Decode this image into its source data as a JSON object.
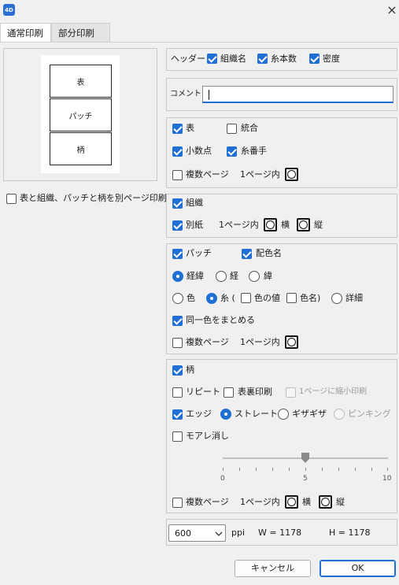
{
  "window": {
    "app_icon": "4D",
    "close_icon": "×"
  },
  "tabs": [
    {
      "label": "通常印刷"
    },
    {
      "label": "部分印刷"
    }
  ],
  "preview": {
    "boxes": [
      "表",
      "パッチ",
      "柄"
    ]
  },
  "separate_pages": {
    "label": "表と組織、パッチと柄を別ページ印刷",
    "checked": false
  },
  "header": {
    "label": "ヘッダー",
    "org_name": {
      "label": "組織名",
      "checked": true
    },
    "yarn_count": {
      "label": "糸本数",
      "checked": true
    },
    "density": {
      "label": "密度",
      "checked": true
    }
  },
  "comment": {
    "label": "コメント",
    "value": ""
  },
  "table": {
    "table": {
      "label": "表",
      "checked": true
    },
    "merge": {
      "label": "統合",
      "checked": false
    },
    "decimal": {
      "label": "小数点",
      "checked": true
    },
    "yarn_no": {
      "label": "糸番手",
      "checked": true
    },
    "multi_page": {
      "label": "複数ページ",
      "checked": false
    },
    "within_1page": "1ページ内"
  },
  "weave": {
    "weave": {
      "label": "組織",
      "checked": true
    },
    "separate_paper": {
      "label": "別紙",
      "checked": true
    },
    "within_1page": "1ページ内",
    "horizontal": "横",
    "vertical": "縦"
  },
  "patch": {
    "patch": {
      "label": "パッチ",
      "checked": true
    },
    "color_name": {
      "label": "配色名",
      "checked": true
    },
    "warp_weft": "経緯",
    "warp": "経",
    "weft": "緯",
    "color": "色",
    "yarn": "糸 (",
    "color_value": "色の値",
    "color_name2": "色名)",
    "detail": "詳細",
    "group_same": {
      "label": "同一色をまとめる",
      "checked": true
    },
    "multi_page": {
      "label": "複数ページ",
      "checked": false
    },
    "within_1page": "1ページ内"
  },
  "pattern": {
    "pattern": {
      "label": "柄",
      "checked": true
    },
    "repeat": {
      "label": "リピート",
      "checked": false
    },
    "front_back": {
      "label": "表裏印刷",
      "checked": false
    },
    "shrink": {
      "label": "1ページに縮小印刷",
      "checked": false
    },
    "edge": {
      "label": "エッジ",
      "checked": true
    },
    "straight": "ストレート",
    "zigzag": "ギザギザ",
    "pinking": "ピンキング",
    "moire": {
      "label": "モアレ消し",
      "checked": false
    },
    "slider": {
      "min": "0",
      "mid": "5",
      "max": "10",
      "value": 5
    },
    "multi_page": {
      "label": "複数ページ",
      "checked": false
    },
    "within_1page": "1ページ内",
    "horizontal": "横",
    "vertical": "縦"
  },
  "resolution": {
    "value": "600",
    "unit": "ppi",
    "width": "W = 1178",
    "height": "H = 1178"
  },
  "buttons": {
    "cancel": "キャンセル",
    "ok": "OK"
  },
  "colors": {
    "accent": "#1f6fd4",
    "background": "#f0f0f0"
  }
}
